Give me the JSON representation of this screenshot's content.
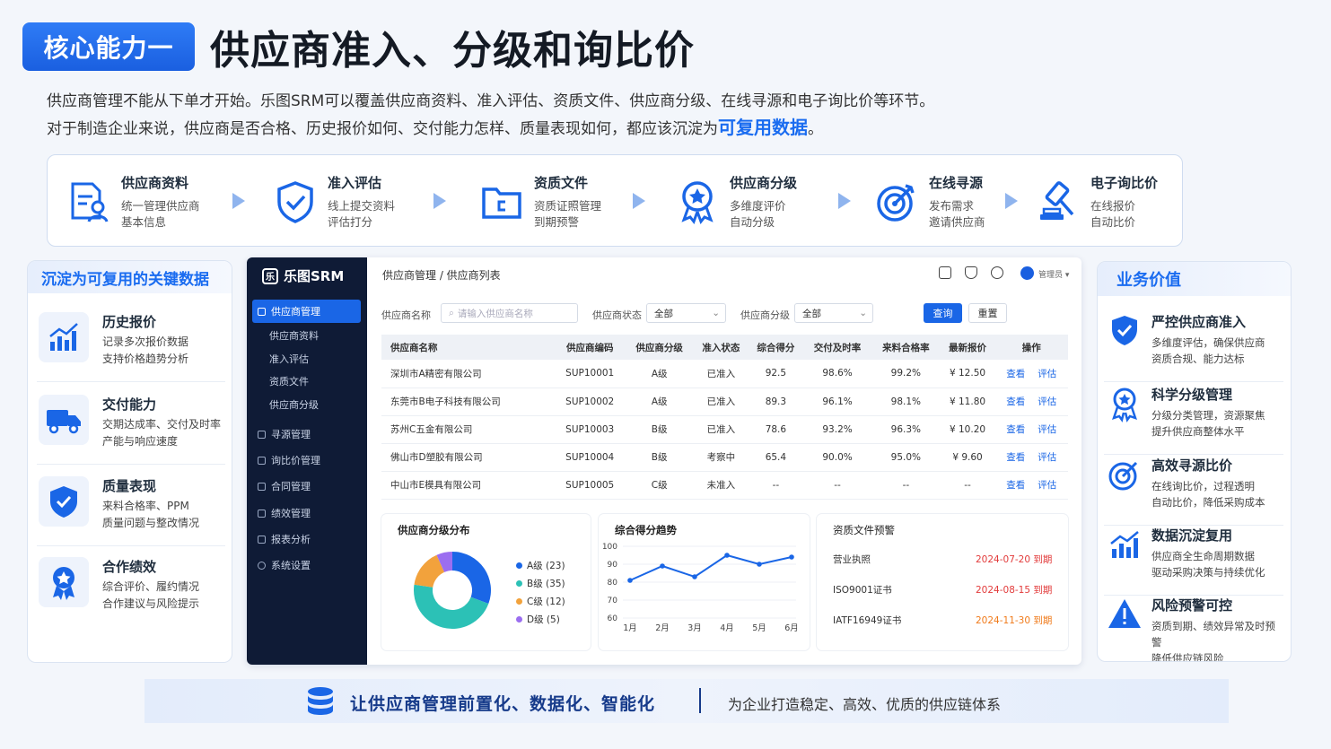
{
  "header": {
    "badge": "核心能力一",
    "title": "供应商准入、分级和询比价"
  },
  "intro": {
    "line1": "供应商管理不能从下单才开始。乐图SRM可以覆盖供应商资料、准入评估、资质文件、供应商分级、在线寻源和电子询比价等环节。",
    "line2_pre": "对于制造企业来说，供应商是否合格、历史报价如何、交付能力怎样、质量表现如何，都应该沉淀为",
    "line2_hl": "可复用数据",
    "line2_post": "。"
  },
  "flow": [
    {
      "title": "供应商资料",
      "desc": "统一管理供应商\n基本信息",
      "icon": "supplier-profile-icon"
    },
    {
      "title": "准入评估",
      "desc": "线上提交资料\n评估打分",
      "icon": "shield-check-icon"
    },
    {
      "title": "资质文件",
      "desc": "资质证照管理\n到期预警",
      "icon": "folder-icon"
    },
    {
      "title": "供应商分级",
      "desc": "多维度评价\n自动分级",
      "icon": "award-star-icon"
    },
    {
      "title": "在线寻源",
      "desc": "发布需求\n邀请供应商",
      "icon": "target-icon"
    },
    {
      "title": "电子询比价",
      "desc": "在线报价\n自动比价",
      "icon": "gavel-icon"
    }
  ],
  "left_panel": {
    "title": "沉淀为可复用的关键数据",
    "items": [
      {
        "title": "历史报价",
        "desc": "记录多次报价数据\n支持价格趋势分析",
        "icon": "bar-trend-icon"
      },
      {
        "title": "交付能力",
        "desc": "交期达成率、交付及时率\n产能与响应速度",
        "icon": "truck-icon"
      },
      {
        "title": "质量表现",
        "desc": "来料合格率、PPM\n质量问题与整改情况",
        "icon": "shield-check-icon"
      },
      {
        "title": "合作绩效",
        "desc": "综合评价、履约情况\n合作建议与风险提示",
        "icon": "medal-icon"
      }
    ]
  },
  "app": {
    "logo": "乐图SRM",
    "menu": [
      {
        "label": "供应商管理",
        "type": "active"
      },
      {
        "label": "供应商资料",
        "type": "sub"
      },
      {
        "label": "准入评估",
        "type": "sub"
      },
      {
        "label": "资质文件",
        "type": "sub"
      },
      {
        "label": "供应商分级",
        "type": "sub"
      },
      {
        "label": "寻源管理",
        "type": "top"
      },
      {
        "label": "询比价管理",
        "type": "top"
      },
      {
        "label": "合同管理",
        "type": "top"
      },
      {
        "label": "绩效管理",
        "type": "top"
      },
      {
        "label": "报表分析",
        "type": "top"
      },
      {
        "label": "系统设置",
        "type": "top"
      }
    ],
    "breadcrumb": "供应商管理 / 供应商列表",
    "user": "管理员",
    "filters": {
      "name_label": "供应商名称",
      "name_placeholder": "请输入供应商名称",
      "status_label": "供应商状态",
      "status_value": "全部",
      "grade_label": "供应商分级",
      "grade_value": "全部",
      "query": "查询",
      "reset": "重置"
    },
    "table": {
      "headers": [
        "供应商名称",
        "供应商编码",
        "供应商分级",
        "准入状态",
        "综合得分",
        "交付及时率",
        "来料合格率",
        "最新报价",
        "操作"
      ],
      "rows": [
        [
          "深圳市A精密有限公司",
          "SUP10001",
          "A级",
          "已准入",
          "92.5",
          "98.6%",
          "99.2%",
          "¥ 12.50"
        ],
        [
          "东莞市B电子科技有限公司",
          "SUP10002",
          "A级",
          "已准入",
          "89.3",
          "96.1%",
          "98.1%",
          "¥ 11.80"
        ],
        [
          "苏州C五金有限公司",
          "SUP10003",
          "B级",
          "已准入",
          "78.6",
          "93.2%",
          "96.3%",
          "¥ 10.20"
        ],
        [
          "佛山市D塑胶有限公司",
          "SUP10004",
          "B级",
          "考察中",
          "65.4",
          "90.0%",
          "95.0%",
          "¥  9.60"
        ],
        [
          "中山市E模具有限公司",
          "SUP10005",
          "C级",
          "未准入",
          "--",
          "--",
          "--",
          "--"
        ]
      ],
      "op_view": "查看",
      "op_eval": "评估"
    },
    "pie_card": {
      "title": "供应商分级分布"
    },
    "line_card": {
      "title": "综合得分趋势"
    },
    "docs_card": {
      "title": "资质文件预警",
      "items": [
        {
          "name": "营业执照",
          "date": "2024-07-20 到期",
          "color": "#e23b3b"
        },
        {
          "name": "ISO9001证书",
          "date": "2024-08-15 到期",
          "color": "#e23b3b"
        },
        {
          "name": "IATF16949证书",
          "date": "2024-11-30 到期",
          "color": "#f07a1a"
        }
      ]
    }
  },
  "chart_data": [
    {
      "type": "pie",
      "title": "供应商分级分布",
      "labels": [
        "A级 (23)",
        "B级 (35)",
        "C级 (12)",
        "D级 (5)"
      ],
      "values": [
        23,
        35,
        12,
        5
      ],
      "colors": [
        "#1a66e6",
        "#2cc1b6",
        "#f2a23c",
        "#9b6ef0"
      ]
    },
    {
      "type": "line",
      "title": "综合得分趋势",
      "categories": [
        "1月",
        "2月",
        "3月",
        "4月",
        "5月",
        "6月"
      ],
      "values": [
        81,
        89,
        83,
        95,
        90,
        94
      ],
      "ylim": [
        60,
        100
      ],
      "yticks": [
        100,
        90,
        80,
        70,
        60
      ]
    }
  ],
  "right_panel": {
    "title": "业务价值",
    "items": [
      {
        "title": "严控供应商准入",
        "desc": "多维度评估，确保供应商\n资质合规、能力达标",
        "icon": "shield-check-icon"
      },
      {
        "title": "科学分级管理",
        "desc": "分级分类管理，资源聚焦\n提升供应商整体水平",
        "icon": "medal-icon"
      },
      {
        "title": "高效寻源比价",
        "desc": "在线询比价，过程透明\n自动比价，降低采购成本",
        "icon": "target-icon"
      },
      {
        "title": "数据沉淀复用",
        "desc": "供应商全生命周期数据\n驱动采购决策与持续优化",
        "icon": "bar-trend-icon"
      },
      {
        "title": "风险预警可控",
        "desc": "资质到期、绩效异常及时预警\n降低供应链风险",
        "icon": "warning-icon"
      }
    ]
  },
  "footer": {
    "main": "让供应商管理前置化、数据化、智能化",
    "sub": "为企业打造稳定、高效、优质的供应链体系"
  }
}
